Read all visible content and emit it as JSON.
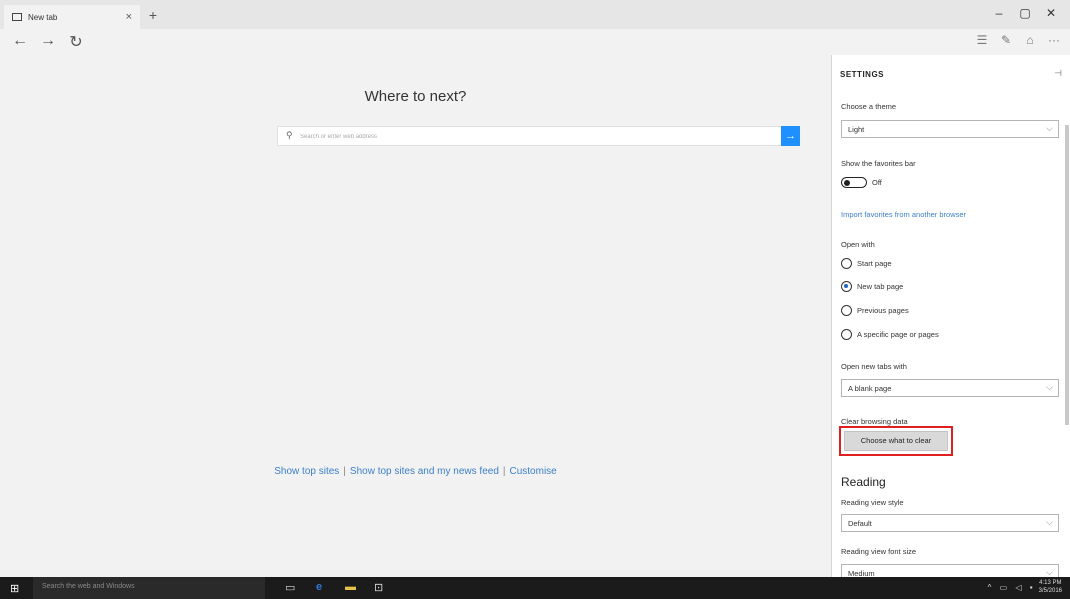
{
  "browser": {
    "tab_title": "New tab",
    "tab_close": "×",
    "new_tab": "+",
    "window_controls": {
      "minimize": "–",
      "maximize": "▢",
      "close": "✕"
    },
    "nav": {
      "back": "←",
      "forward": "→",
      "refresh": "↻"
    },
    "toolbar": {
      "hub": "☰",
      "note": "✎",
      "share": "⌂",
      "more": "···"
    }
  },
  "content": {
    "heading": "Where to next?",
    "search_placeholder": "Search or enter web address",
    "search_go": "→",
    "links": [
      "Show top sites",
      "Show top sites and my news feed",
      "Customise"
    ],
    "separator": "|"
  },
  "settings": {
    "title": "SETTINGS",
    "theme_label": "Choose a theme",
    "theme_value": "Light",
    "favorites_bar_label": "Show the favorites bar",
    "favorites_bar_state": "Off",
    "import_link": "Import favorites from another browser",
    "open_with_label": "Open with",
    "open_with_options": [
      "Start page",
      "New tab page",
      "Previous pages",
      "A specific page or pages"
    ],
    "open_with_selected": "New tab page",
    "new_tabs_label": "Open new tabs with",
    "new_tabs_value": "A blank page",
    "clear_data_label": "Clear browsing data",
    "clear_button": "Choose what to clear",
    "reading_heading": "Reading",
    "reading_style_label": "Reading view style",
    "reading_style_value": "Default",
    "reading_font_label": "Reading view font size",
    "reading_font_value": "Medium"
  },
  "taskbar": {
    "search_placeholder": "Search the web and Windows",
    "time": "4:13 PM",
    "date": "3/5/2016"
  }
}
